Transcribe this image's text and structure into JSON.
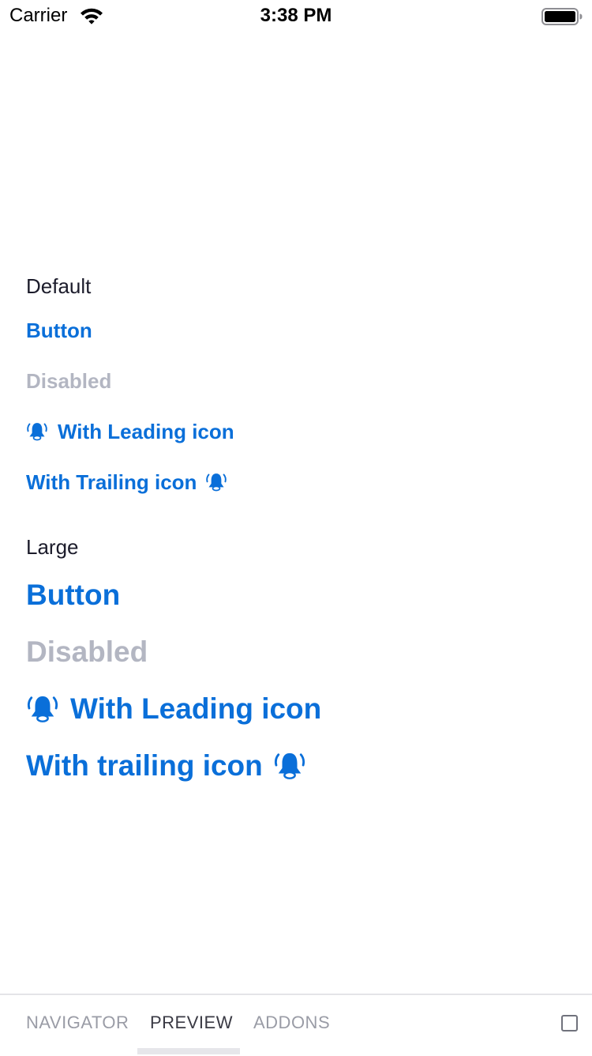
{
  "status_bar": {
    "carrier": "Carrier",
    "time": "3:38 PM",
    "wifi_icon": "wifi-icon",
    "battery_icon": "battery-full-icon"
  },
  "sections": {
    "default": {
      "label": "Default",
      "button": "Button",
      "disabled": "Disabled",
      "leading_icon": "With Leading icon",
      "trailing_icon": "With Trailing icon"
    },
    "large": {
      "label": "Large",
      "button": "Button",
      "disabled": "Disabled",
      "leading_icon": "With Leading icon",
      "trailing_icon": "With trailing icon"
    }
  },
  "icons": {
    "bell": "bell-ringing-icon"
  },
  "tab_bar": {
    "tabs": [
      {
        "label": "NAVIGATOR",
        "active": false
      },
      {
        "label": "PREVIEW",
        "active": true
      },
      {
        "label": "ADDONS",
        "active": false
      }
    ],
    "checkbox_checked": false
  },
  "colors": {
    "accent": "#0a6fd9",
    "disabled": "#b3b6c2",
    "text": "#1c1c2b",
    "tab_inactive": "#9a9ca6",
    "tab_active": "#3a3a44",
    "divider": "#e4e4e8"
  }
}
